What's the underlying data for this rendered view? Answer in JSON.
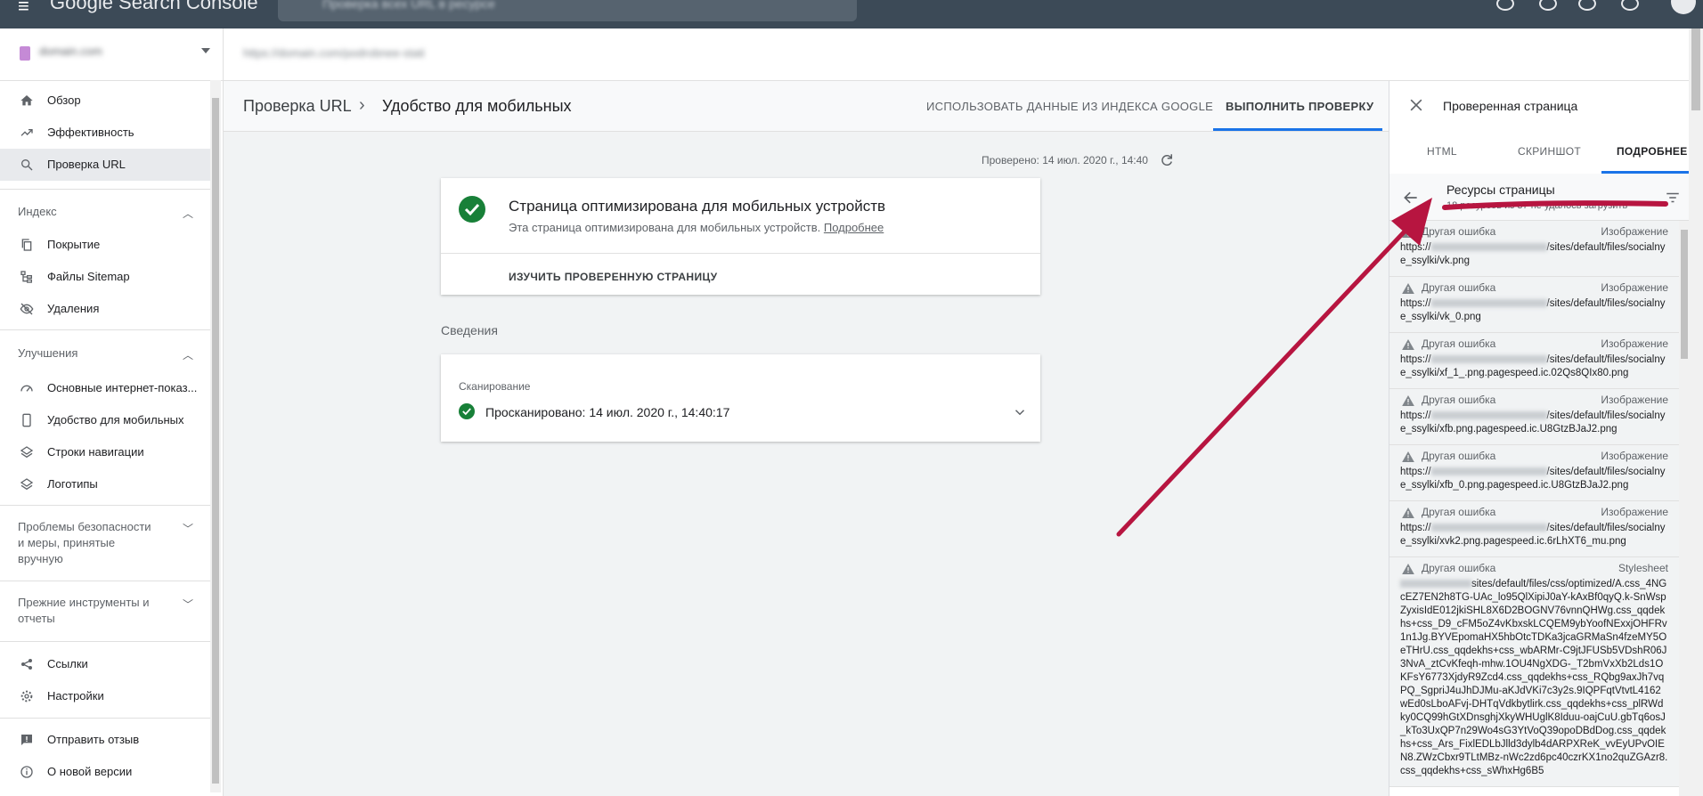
{
  "app": {
    "title": "Google Search Console",
    "search_placeholder": "Проверка всех URL в ресурсе",
    "property_name": "domain.com",
    "url_value": "https://domain.com/podrobnee-stati"
  },
  "sidebar": {
    "top_items": [
      {
        "label": "Обзор"
      },
      {
        "label": "Эффективность"
      },
      {
        "label": "Проверка URL"
      }
    ],
    "index_section": {
      "title": "Индекс",
      "items": [
        {
          "label": "Покрытие"
        },
        {
          "label": "Файлы Sitemap"
        },
        {
          "label": "Удаления"
        }
      ]
    },
    "improvements_section": {
      "title": "Улучшения",
      "items": [
        {
          "label": "Основные интернет-показ..."
        },
        {
          "label": "Удобство для мобильных"
        },
        {
          "label": "Строки навигации"
        },
        {
          "label": "Логотипы"
        }
      ]
    },
    "security_section": {
      "title_lines": [
        "Проблемы безопасности",
        "и меры, принятые",
        "вручную"
      ]
    },
    "legacy_section": {
      "title_lines": [
        "Прежние инструменты и",
        "отчеты"
      ]
    },
    "bottom_items": [
      {
        "label": "Ссылки"
      },
      {
        "label": "Настройки"
      }
    ],
    "footer_items": [
      {
        "label": "Отправить отзыв"
      },
      {
        "label": "О новой версии"
      }
    ]
  },
  "main": {
    "breadcrumb_root": "Проверка URL",
    "breadcrumb_current": "Удобство для мобильных",
    "use_index_button": "ИСПОЛЬЗОВАТЬ ДАННЫЕ ИЗ ИНДЕКСА GOOGLE",
    "run_test_button": "ВЫПОЛНИТЬ ПРОВЕРКУ",
    "tested_text": "Проверено: 14 июл. 2020 г., 14:40",
    "result_title": "Страница оптимизирована для мобильных устройств",
    "result_desc": "Эта страница оптимизирована для мобильных устройств.",
    "result_more_link": "Подробнее",
    "view_page_button": "ИЗУЧИТЬ ПРОВЕРЕННУЮ СТРАНИЦУ",
    "details_heading": "Сведения",
    "crawl_label": "Сканирование",
    "crawl_value": "Просканировано: 14 июл. 2020 г., 14:40:17"
  },
  "panel": {
    "title": "Проверенная страница",
    "tabs": [
      {
        "label": "HTML"
      },
      {
        "label": "СКРИНШОТ"
      },
      {
        "label": "ПОДРОБНЕЕ"
      }
    ],
    "resources_title": "Ресурсы страницы",
    "resources_subtitle": "18 ресурсов из 37 не удалось загрузить",
    "resources": [
      {
        "error": "Другая ошибка",
        "type": "Изображение",
        "url_prefix": "https://",
        "url_suffix": "/sites/default/files/socialnye_ssylki/vk.png"
      },
      {
        "error": "Другая ошибка",
        "type": "Изображение",
        "url_prefix": "https://",
        "url_suffix": "/sites/default/files/socialnye_ssylki/vk_0.png"
      },
      {
        "error": "Другая ошибка",
        "type": "Изображение",
        "url_prefix": "https://",
        "url_suffix": "/sites/default/files/socialnye_ssylki/xf_1_.png.pagespeed.ic.02Qs8QIx80.png"
      },
      {
        "error": "Другая ошибка",
        "type": "Изображение",
        "url_prefix": "https://",
        "url_suffix": "/sites/default/files/socialnye_ssylki/xfb.png.pagespeed.ic.U8GtzBJaJ2.png"
      },
      {
        "error": "Другая ошибка",
        "type": "Изображение",
        "url_prefix": "https://",
        "url_suffix": "/sites/default/files/socialnye_ssylki/xfb_0.png.pagespeed.ic.U8GtzBJaJ2.png"
      },
      {
        "error": "Другая ошибка",
        "type": "Изображение",
        "url_prefix": "https://",
        "url_suffix": "/sites/default/files/socialnye_ssylki/xvk2.png.pagespeed.ic.6rLhXT6_mu.png"
      },
      {
        "error": "Другая ошибка",
        "type": "Stylesheet",
        "url_prefix": "",
        "url_suffix": "sites/default/files/css/optimized/A.css_4NGcEZ7EN2h8TG-UAc_lo95QlXipiJ0aY-kAxBf0qyQ.k-SnWspZyxisIdE012jkiSHL8X6D2BOGNV76vnnQHWg.css_qqdekhs+css_D9_cFM5oZ4vKbxskLCQEM9ybYoofNExxjOHFRv1n1Jg.BYVEpomaHX5hbOtcTDKa3jcaGRMaSn4fzeMY5OeTHrU.css_qqdekhs+css_wbARMr-C9jtJFUSb5VDshR06J3NvA_ztCvKfeqh-mhw.1OU4NgXDG-_T2bmVxXb2Lds1OKFsY6773XjdyR9Zcd4.css_qqdekhs+css_RQbg9axJh7vqPQ_SgpriJ4uJhDJMu-aKJdVKi7c3y2s.9IQPFqtVtvtL4162wEd0sLboAFvj-DHTqVdkbytlirk.css_qqdekhs+css_plRWdky0CQ99hGtXDnsghjXkyWHUglK8Iduu-oajCuU.gbTq6osJ_kTo3UxQP7n29Wo4sG3YtVoQ39opoDBdDog.css_qqdekhs+css_Ars_FixlEDLbJlld3dylb4dARPXReK_vvEyUPvOIEN8.ZWzCbxr9TLtMBz-nWc2zd6pc40czrKX1no2quZGAzr8.css_qqdekhs+css_sWhxHg6B5"
      }
    ]
  },
  "colors": {
    "accent": "#1a73e8",
    "success": "#188038",
    "annotation": "#b71540"
  }
}
